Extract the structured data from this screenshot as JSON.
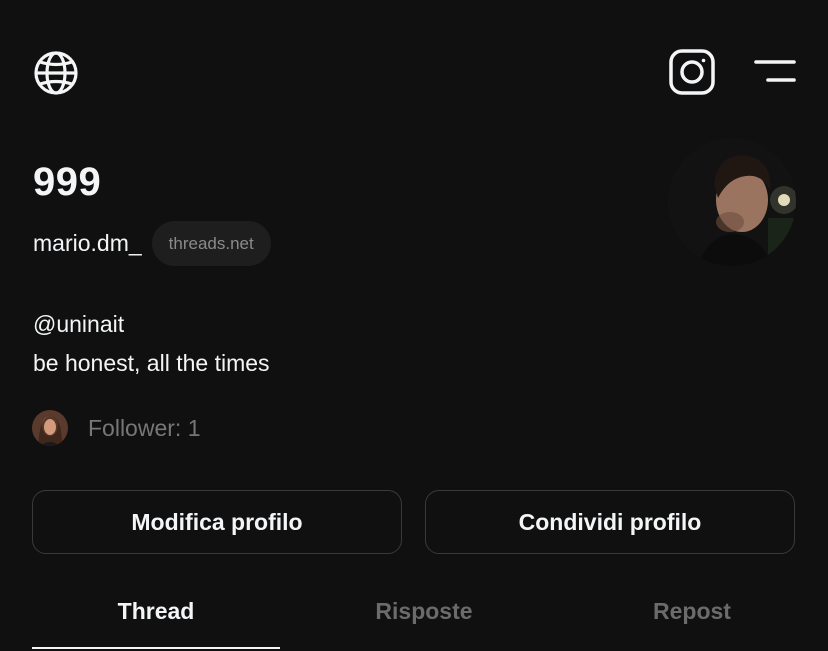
{
  "header": {
    "globe_icon": "globe-icon",
    "instagram_icon": "instagram-icon",
    "menu_icon": "menu-icon"
  },
  "profile": {
    "display_name": "999",
    "username": "mario.dm_",
    "domain_badge": "threads.net",
    "bio_lines": [
      "@uninait",
      "be honest, all the times"
    ],
    "followers_text": "Follower: 1"
  },
  "actions": {
    "edit_label": "Modifica profilo",
    "share_label": "Condividi profilo"
  },
  "tabs": [
    {
      "label": "Thread",
      "active": true
    },
    {
      "label": "Risposte",
      "active": false
    },
    {
      "label": "Repost",
      "active": false
    }
  ],
  "colors": {
    "background": "#101010",
    "text_primary": "#f3f5f7",
    "text_muted": "#6b6b6b",
    "border": "#3a3a3a"
  }
}
